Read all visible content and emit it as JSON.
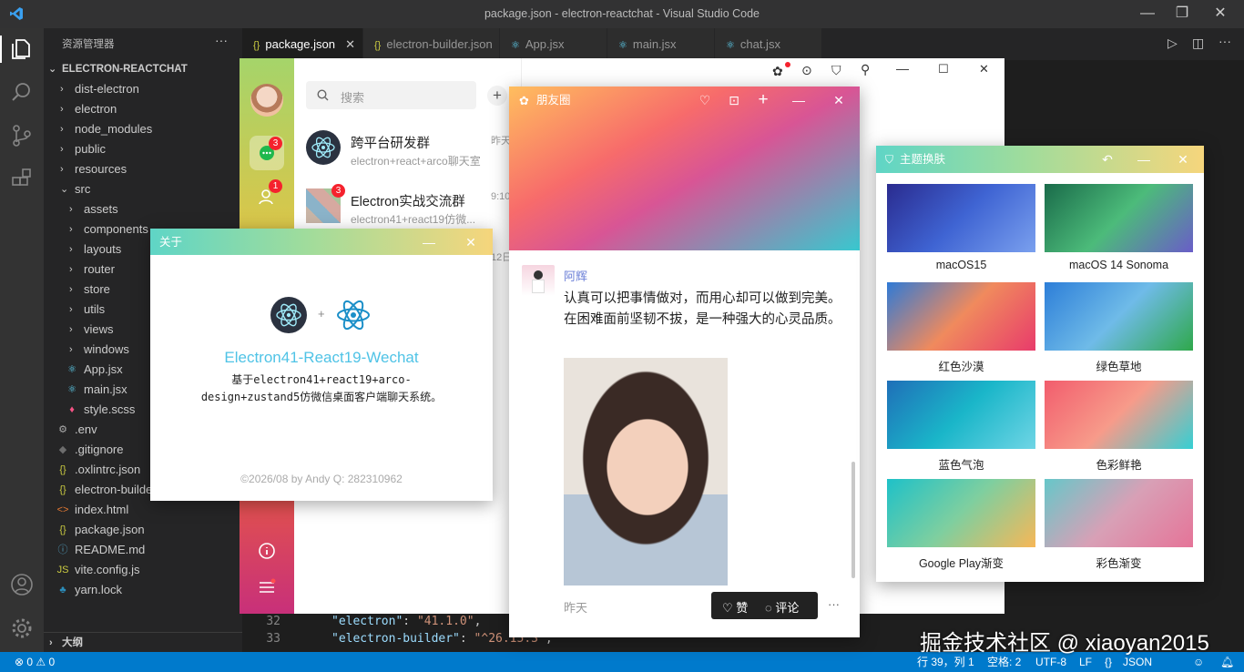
{
  "window": {
    "title": "package.json - electron-reactchat - Visual Studio Code"
  },
  "sidebar": {
    "header": "资源管理器",
    "root": "ELECTRON-REACTCHAT",
    "items": [
      {
        "label": "dist-electron",
        "kind": "folder",
        "depth": 1
      },
      {
        "label": "electron",
        "kind": "folder",
        "depth": 1
      },
      {
        "label": "node_modules",
        "kind": "folder",
        "depth": 1
      },
      {
        "label": "public",
        "kind": "folder",
        "depth": 1
      },
      {
        "label": "resources",
        "kind": "folder",
        "depth": 1
      },
      {
        "label": "src",
        "kind": "folder-open",
        "depth": 1
      },
      {
        "label": "assets",
        "kind": "folder",
        "depth": 2
      },
      {
        "label": "components",
        "kind": "folder",
        "depth": 2
      },
      {
        "label": "layouts",
        "kind": "folder",
        "depth": 2
      },
      {
        "label": "router",
        "kind": "folder",
        "depth": 2
      },
      {
        "label": "store",
        "kind": "folder",
        "depth": 2
      },
      {
        "label": "utils",
        "kind": "folder",
        "depth": 2
      },
      {
        "label": "views",
        "kind": "folder",
        "depth": 2
      },
      {
        "label": "windows",
        "kind": "folder",
        "depth": 2
      },
      {
        "label": "App.jsx",
        "kind": "react",
        "depth": 2
      },
      {
        "label": "main.jsx",
        "kind": "react",
        "depth": 2
      },
      {
        "label": "style.scss",
        "kind": "scss",
        "depth": 2
      },
      {
        "label": ".env",
        "kind": "gear",
        "depth": 1
      },
      {
        "label": ".gitignore",
        "kind": "git",
        "depth": 1
      },
      {
        "label": ".oxlintrc.json",
        "kind": "json",
        "depth": 1
      },
      {
        "label": "electron-builde",
        "kind": "json",
        "depth": 1
      },
      {
        "label": "index.html",
        "kind": "html",
        "depth": 1
      },
      {
        "label": "package.json",
        "kind": "json",
        "depth": 1
      },
      {
        "label": "README.md",
        "kind": "info",
        "depth": 1
      },
      {
        "label": "vite.config.js",
        "kind": "js",
        "depth": 1
      },
      {
        "label": "yarn.lock",
        "kind": "yarn",
        "depth": 1
      }
    ],
    "outline": "大纲"
  },
  "tabs": [
    {
      "label": "package.json",
      "icon": "{}",
      "active": true
    },
    {
      "label": "electron-builder.json",
      "icon": "{}"
    },
    {
      "label": "App.jsx",
      "icon": "⚛"
    },
    {
      "label": "main.jsx",
      "icon": "⚛"
    },
    {
      "label": "chat.jsx",
      "icon": "⚛"
    }
  ],
  "code": {
    "lines": [
      {
        "num": "32",
        "key": "\"electron\"",
        "val": "\"41.1.0\"",
        "tail": ","
      },
      {
        "num": "33",
        "key": "\"electron-builder\"",
        "val": "\"^26.15.3\"",
        "tail": ","
      }
    ]
  },
  "status": {
    "errors": "0",
    "warnings": "0",
    "position": "行 39，列 1",
    "spaces": "空格: 2",
    "encoding": "UTF-8",
    "eol": "LF",
    "language": "JSON"
  },
  "chat": {
    "search_placeholder": "搜索",
    "nav_badges": [
      "3",
      "1"
    ],
    "list": [
      {
        "name": "跨平台研发群",
        "preview": "electron+react+arco聊天室",
        "time": "昨天"
      },
      {
        "name": "Electron实战交流群",
        "preview": "electron41+react19仿微...",
        "time": "9:10",
        "badge": "3"
      },
      {
        "name": "",
        "preview": "",
        "time": "12日"
      }
    ]
  },
  "about": {
    "title": "关于",
    "plus": "+",
    "app_name": "Electron41-React19-Wechat",
    "desc": "基于electron41+react19+arco-design+zustand5仿微信桌面客户端聊天系统。",
    "footer": "©2026/08 by Andy   Q: 282310962",
    "accent": "#4fc3e6"
  },
  "moments": {
    "title": "朋友圈",
    "author": "阿辉",
    "text": "认真可以把事情做对，而用心却可以做到完美。在困难面前坚韧不拔，是一种强大的心灵品质。",
    "time": "昨天",
    "like": "赞",
    "comment": "评论",
    "more": "···",
    "author_color": "#6b7fd7"
  },
  "theme": {
    "title": "主题换肤",
    "items": [
      {
        "label": "macOS15",
        "colors": [
          "#2a2b8f",
          "#3f64d3",
          "#7aa0ee"
        ]
      },
      {
        "label": "macOS 14 Sonoma",
        "colors": [
          "#1a6b4a",
          "#4cbb7a",
          "#6a5dc8"
        ]
      },
      {
        "label": "红色沙漠",
        "colors": [
          "#2f7ad6",
          "#f08a5d",
          "#e83b6b"
        ]
      },
      {
        "label": "绿色草地",
        "colors": [
          "#2d7ed8",
          "#6fbbe8",
          "#2fa84b"
        ]
      },
      {
        "label": "蓝色气泡",
        "colors": [
          "#1f6fb8",
          "#1ab6c9",
          "#6fd5e5"
        ]
      },
      {
        "label": "色彩鲜艳",
        "colors": [
          "#f25d6d",
          "#f79b8a",
          "#35cfd3"
        ]
      },
      {
        "label": "Google Play渐变",
        "colors": [
          "#1ec1c8",
          "#7fcf9f",
          "#f7b757"
        ]
      },
      {
        "label": "彩色渐变",
        "colors": [
          "#66c7c9",
          "#d8a0b6",
          "#e57498"
        ]
      }
    ]
  },
  "watermark": "掘金技术社区 @ xiaoyan2015"
}
